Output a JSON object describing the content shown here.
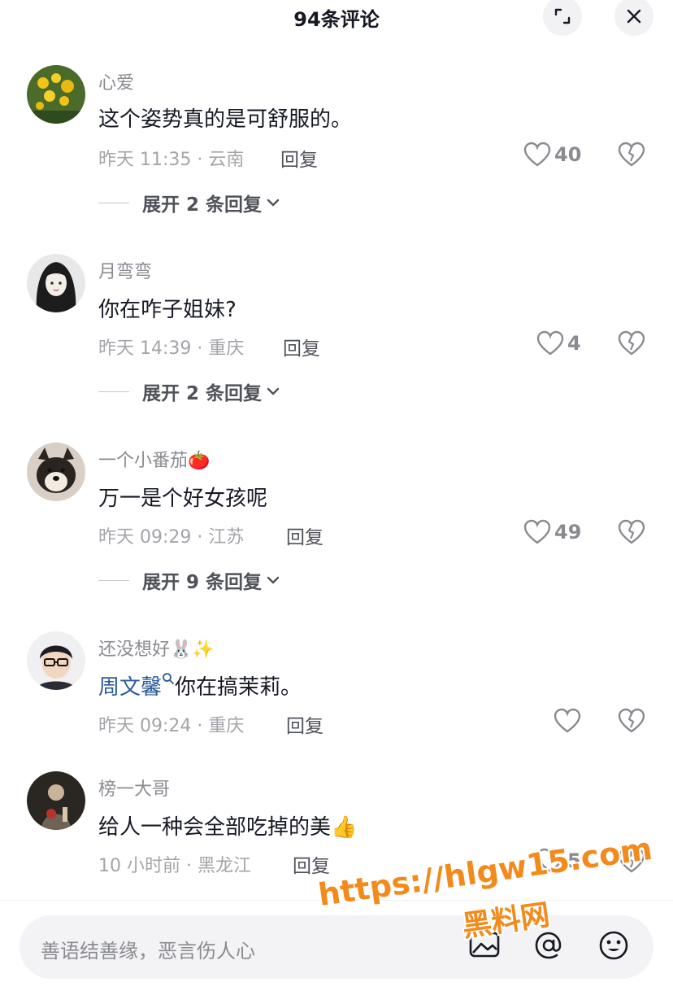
{
  "header": {
    "title": "94条评论",
    "expand_icon": "expand-icon",
    "close_icon": "close-icon"
  },
  "comments": [
    {
      "username": "心爱",
      "text": "这个姿势真的是可舒服的。",
      "meta": "昨天 11:35 · 云南",
      "reply_label": "回复",
      "likes": "40",
      "expand_label": "展开 2 条回复",
      "avatar": "yellow-flowers"
    },
    {
      "username": "月弯弯",
      "text": "你在咋子姐妹?",
      "meta": "昨天 14:39 · 重庆",
      "reply_label": "回复",
      "likes": "4",
      "expand_label": "展开 2 条回复",
      "avatar": "anime-girl"
    },
    {
      "username": "一个小番茄🍅",
      "text": "万一是个好女孩呢",
      "meta": "昨天 09:29 · 江苏",
      "reply_label": "回复",
      "likes": "49",
      "expand_label": "展开 9 条回复",
      "avatar": "shiba-dog"
    },
    {
      "username": "还没想好🐰✨",
      "mention": "周文馨",
      "text": "你在搞茉莉。",
      "meta": "昨天 09:24 · 重庆",
      "reply_label": "回复",
      "likes": "",
      "avatar": "cartoon-boy"
    },
    {
      "username": "榜一大哥",
      "text": "给人一种会全部吃掉的美👍",
      "meta": "10 小时前 · 黑龙江",
      "reply_label": "回复",
      "likes": "5",
      "avatar": "dark-figure"
    }
  ],
  "input_bar": {
    "placeholder": "善语结善缘，恶言伤人心",
    "icons": [
      "image-icon",
      "mention-icon",
      "emoji-icon"
    ]
  },
  "watermark": {
    "url": "https://hlgw15.com",
    "label": "黑料网"
  },
  "colors": {
    "text_primary": "#161823",
    "text_secondary": "#8a8b91",
    "mention": "#2a5a9a",
    "watermark": "#f28a1c"
  }
}
